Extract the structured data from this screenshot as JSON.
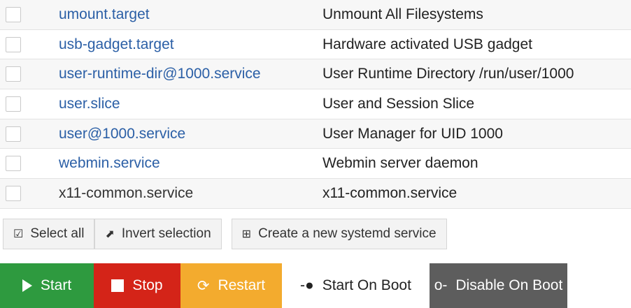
{
  "units": [
    {
      "name": "umount.target",
      "description": "Unmount All Filesystems",
      "link": true
    },
    {
      "name": "usb-gadget.target",
      "description": "Hardware activated USB gadget",
      "link": true
    },
    {
      "name": "user-runtime-dir@1000.service",
      "description": "User Runtime Directory /run/user/1000",
      "link": true
    },
    {
      "name": "user.slice",
      "description": "User and Session Slice",
      "link": true
    },
    {
      "name": "user@1000.service",
      "description": "User Manager for UID 1000",
      "link": true
    },
    {
      "name": "webmin.service",
      "description": "Webmin server daemon",
      "link": true
    },
    {
      "name": "x11-common.service",
      "description": "x11-common.service",
      "link": false
    }
  ],
  "selection": {
    "select_all": "Select all",
    "invert": "Invert selection",
    "create": "Create a new systemd service"
  },
  "actions": {
    "start": "Start",
    "stop": "Stop",
    "restart": "Restart",
    "start_on_boot": "Start On Boot",
    "disable_on_boot": "Disable On Boot"
  },
  "colors": {
    "start": "#2e9a3f",
    "stop": "#d42418",
    "restart": "#f3ab2e",
    "disable": "#5d5d5d",
    "link": "#2b5fa6"
  }
}
